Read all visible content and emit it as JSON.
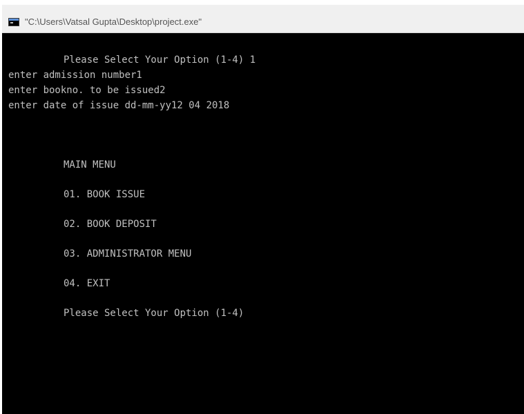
{
  "window": {
    "title": "\"C:\\Users\\Vatsal Gupta\\Desktop\\project.exe\""
  },
  "console": {
    "prompt_line": "Please Select Your Option (1-4) 1",
    "admission_line": "enter admission number1",
    "bookno_line": "enter bookno. to be issued2",
    "date_line": "enter date of issue dd-mm-yy12 04 2018",
    "menu_title": "MAIN MENU",
    "menu_items": [
      "01. BOOK ISSUE",
      "02. BOOK DEPOSIT",
      "03. ADMINISTRATOR MENU",
      "04. EXIT"
    ],
    "final_prompt": "Please Select Your Option (1-4)"
  },
  "colors": {
    "console_bg": "#000000",
    "console_text": "#c0c0c0",
    "titlebar_bg": "#f0f0f0"
  },
  "icons": {
    "app_icon": "console-window-icon"
  }
}
